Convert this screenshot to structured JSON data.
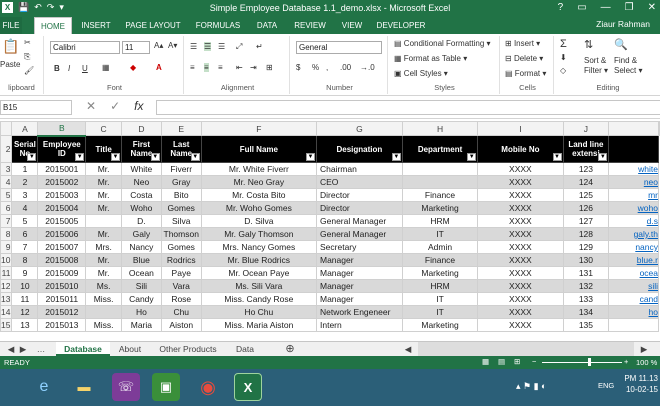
{
  "window": {
    "title": "Simple Employee Database 1.1_demo.xlsx - Microsoft Excel",
    "help": "?",
    "user": "Ziaur Rahman",
    "qat": [
      "💾",
      "↶",
      "↷",
      "▾"
    ],
    "controls": [
      "—",
      "❐",
      "✕"
    ]
  },
  "tabs": [
    "FILE",
    "HOME",
    "INSERT",
    "PAGE LAYOUT",
    "FORMULAS",
    "DATA",
    "REVIEW",
    "VIEW",
    "DEVELOPER"
  ],
  "ribbon": {
    "clipboard": {
      "label": "lipboard",
      "paste": "Paste"
    },
    "font": {
      "label": "Font",
      "family": "Calibri",
      "size": "11",
      "bold": "B",
      "italic": "I",
      "underline": "U"
    },
    "alignment": {
      "label": "Alignment"
    },
    "number": {
      "label": "Number",
      "format": "General",
      "percent": "%",
      "comma": ",",
      "currency": "$",
      "dec1": ".00",
      "dec2": "→.0"
    },
    "styles": {
      "label": "Styles",
      "cond": "Conditional Formatting ▾",
      "table": "Format as Table ▾",
      "cell": "Cell Styles ▾"
    },
    "cells": {
      "label": "Cells",
      "insert": "Insert ▾",
      "delete": "Delete ▾",
      "format": "Format ▾"
    },
    "editing": {
      "label": "Editing",
      "sort": "Sort &",
      "sort2": "Filter ▾",
      "find": "Find &",
      "find2": "Select ▾"
    }
  },
  "formula_bar": {
    "name_box": "B15",
    "fx": "fx",
    "cancel": "✕",
    "enter": "✓"
  },
  "columns": [
    "A",
    "B",
    "C",
    "D",
    "E",
    "F",
    "G",
    "H",
    "I",
    "J"
  ],
  "headers": [
    [
      "Serial",
      "No"
    ],
    [
      "Employee",
      "ID"
    ],
    [
      "Title",
      ""
    ],
    [
      "First",
      "Name"
    ],
    [
      "Last",
      "Name"
    ],
    [
      "Full Name",
      ""
    ],
    [
      "Designation",
      ""
    ],
    [
      "Department",
      ""
    ],
    [
      "Mobile No",
      ""
    ],
    [
      "Land line",
      "extensi"
    ],
    [
      "",
      ""
    ]
  ],
  "rows": [
    {
      "n": "3",
      "c": [
        "1",
        "2015001",
        "Mr.",
        "White",
        "Fiverr",
        "Mr. White Fiverr",
        "Chairman",
        "",
        "XXXX",
        "123",
        "white"
      ]
    },
    {
      "n": "4",
      "c": [
        "2",
        "2015002",
        "Mr.",
        "Neo",
        "Gray",
        "Mr. Neo Gray",
        "CEO",
        "",
        "XXXX",
        "124",
        "neo"
      ]
    },
    {
      "n": "5",
      "c": [
        "3",
        "2015003",
        "Mr.",
        "Costa",
        "Bito",
        "Mr. Costa Bito",
        "Director",
        "Finance",
        "XXXX",
        "125",
        "mr"
      ]
    },
    {
      "n": "6",
      "c": [
        "4",
        "2015004",
        "Mr.",
        "Woho",
        "Gomes",
        "Mr. Woho Gomes",
        "Director",
        "Marketing",
        "XXXX",
        "126",
        "woho"
      ]
    },
    {
      "n": "7",
      "c": [
        "5",
        "2015005",
        "",
        "D.",
        "Silva",
        "D. Silva",
        "General Manager",
        "HRM",
        "XXXX",
        "127",
        "d.s"
      ]
    },
    {
      "n": "8",
      "c": [
        "6",
        "2015006",
        "Mr.",
        "Galy",
        "Thomson",
        "Mr. Galy Thomson",
        "General Manager",
        "IT",
        "XXXX",
        "128",
        "galy.th"
      ]
    },
    {
      "n": "9",
      "c": [
        "7",
        "2015007",
        "Mrs.",
        "Nancy",
        "Gomes",
        "Mrs. Nancy Gomes",
        "Secretary",
        "Admin",
        "XXXX",
        "129",
        "nancy"
      ]
    },
    {
      "n": "10",
      "c": [
        "8",
        "2015008",
        "Mr.",
        "Blue",
        "Rodrics",
        "Mr. Blue Rodrics",
        "Manager",
        "Finance",
        "XXXX",
        "130",
        "blue.r"
      ]
    },
    {
      "n": "11",
      "c": [
        "9",
        "2015009",
        "Mr.",
        "Ocean",
        "Paye",
        "Mr. Ocean Paye",
        "Manager",
        "Marketing",
        "XXXX",
        "131",
        "ocea"
      ]
    },
    {
      "n": "12",
      "c": [
        "10",
        "2015010",
        "Ms.",
        "Sili",
        "Vara",
        "Ms. Sili Vara",
        "Manager",
        "HRM",
        "XXXX",
        "132",
        "sili"
      ]
    },
    {
      "n": "13",
      "c": [
        "11",
        "2015011",
        "Miss.",
        "Candy",
        "Rose",
        "Miss. Candy Rose",
        "Manager",
        "IT",
        "XXXX",
        "133",
        "cand"
      ]
    },
    {
      "n": "14",
      "c": [
        "12",
        "2015012",
        "",
        "Ho",
        "Chu",
        "Ho Chu",
        "Network Engeneer",
        "IT",
        "XXXX",
        "134",
        "ho"
      ]
    },
    {
      "n": "15",
      "c": [
        "13",
        "2015013",
        "Miss.",
        "Maria",
        "Aiston",
        "Miss. Maria Aiston",
        "Intern",
        "Marketing",
        "XXXX",
        "135",
        ""
      ]
    }
  ],
  "sheets": [
    "Database",
    "About",
    "Other Products",
    "Data"
  ],
  "status": {
    "ready": "READY",
    "zoom": "100 %"
  },
  "taskbar": {
    "time": "PM 11.13",
    "date": "10-02-15",
    "lang": "ENG"
  },
  "colors": {
    "excel_green": "#217346",
    "header_black": "#000000",
    "stripe": "#d9d9d9",
    "taskbar": "#2b5f78"
  }
}
